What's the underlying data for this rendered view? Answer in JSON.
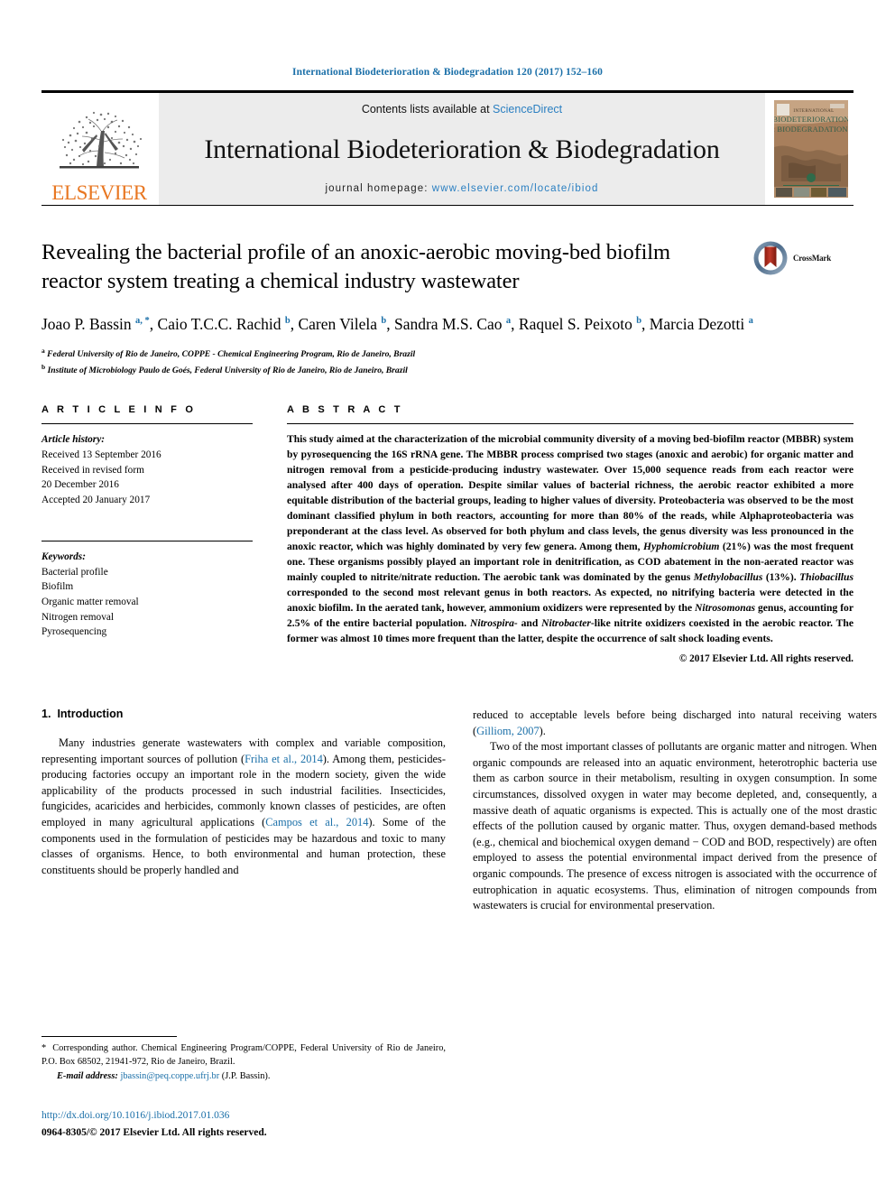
{
  "running_head": "International Biodeterioration & Biodegradation 120 (2017) 152–160",
  "masthead": {
    "elsevier_wordmark": "ELSEVIER",
    "elsevier_logo_color": "#E87722",
    "contents_prefix": "Contents lists available at ",
    "contents_link": "ScienceDirect",
    "journal_name": "International Biodeterioration & Biodegradation",
    "homepage_prefix": "journal homepage: ",
    "homepage_url": "www.elsevier.com/locate/ibiod",
    "link_color": "#2a7fc1",
    "cover_title_line1": "INTERNATIONAL",
    "cover_title_line2": "BIODETERIORATION",
    "cover_title_line3": "& BIODEGRADATION"
  },
  "article": {
    "title": "Revealing the bacterial profile of an anoxic-aerobic moving-bed biofilm reactor system treating a chemical industry wastewater",
    "crossmark_label": "CrossMark",
    "authors": [
      {
        "name": "Joao P. Bassin",
        "marks": "a, *"
      },
      {
        "name": "Caio T.C.C. Rachid",
        "marks": "b"
      },
      {
        "name": "Caren Vilela",
        "marks": "b"
      },
      {
        "name": "Sandra M.S. Cao",
        "marks": "a"
      },
      {
        "name": "Raquel S. Peixoto",
        "marks": "b"
      },
      {
        "name": "Marcia Dezotti",
        "marks": "a"
      }
    ],
    "affiliations": [
      {
        "mark": "a",
        "text": "Federal University of Rio de Janeiro, COPPE - Chemical Engineering Program, Rio de Janeiro, Brazil"
      },
      {
        "mark": "b",
        "text": "Institute of Microbiology Paulo de Goés, Federal University of Rio de Janeiro, Rio de Janeiro, Brazil"
      }
    ]
  },
  "article_info": {
    "heading": "A R T I C L E   I N F O",
    "history_title": "Article history:",
    "history": [
      "Received 13 September 2016",
      "Received in revised form",
      "20 December 2016",
      "Accepted 20 January 2017"
    ],
    "keywords_title": "Keywords:",
    "keywords": [
      "Bacterial profile",
      "Biofilm",
      "Organic matter removal",
      "Nitrogen removal",
      "Pyrosequencing"
    ]
  },
  "abstract": {
    "heading": "A B S T R A C T",
    "paragraph_html": "This study aimed at the characterization of the microbial community diversity of a moving bed-biofilm reactor (MBBR) system by pyrosequencing the 16S rRNA gene. The MBBR process comprised two stages (anoxic and aerobic) for organic matter and nitrogen removal from a pesticide-producing industry wastewater. Over 15,000 sequence reads from each reactor were analysed after 400 days of operation. Despite similar values of bacterial richness, the aerobic reactor exhibited a more equitable distribution of the bacterial groups, leading to higher values of diversity. Proteobacteria was observed to be the most dominant classified phylum in both reactors, accounting for more than 80% of the reads, while Alphaproteobacteria was preponderant at the class level. As observed for both phylum and class levels, the genus diversity was less pronounced in the anoxic reactor, which was highly dominated by very few genera. Among them, <i>Hyphomicrobium</i> (21%) was the most frequent one. These organisms possibly played an important role in denitrification, as COD abatement in the non-aerated reactor was mainly coupled to nitrite/nitrate reduction. The aerobic tank was dominated by the genus <i>Methylobacillus</i> (13%). <i>Thiobacillus</i> corresponded to the second most relevant genus in both reactors. As expected, no nitrifying bacteria were detected in the anoxic biofilm. In the aerated tank, however, ammonium oxidizers were represented by the <i>Nitrosomonas</i> genus, accounting for 2.5% of the entire bacterial population. <i>Nitrospira-</i> and <i>Nitrobacter</i>-like nitrite oxidizers coexisted in the aerobic reactor. The former was almost 10 times more frequent than the latter, despite the occurrence of salt shock loading events.",
    "copyright": "© 2017 Elsevier Ltd. All rights reserved."
  },
  "introduction": {
    "number": "1.",
    "heading": "Introduction",
    "left_paragraph_html": "Many industries generate wastewaters with complex and variable composition, representing important sources of pollution (<span class=\"cite\">Friha et al., 2014</span>). Among them, pesticides-producing factories occupy an important role in the modern society, given the wide applicability of the products processed in such industrial facilities. Insecticides, fungicides, acaricides and herbicides, commonly known classes of pesticides, are often employed in many agricultural applications (<span class=\"cite\">Campos et al., 2014</span>). Some of the components used in the formulation of pesticides may be hazardous and toxic to many classes of organisms. Hence, to both environmental and human protection, these constituents should be properly handled and",
    "right_paragraph1_html": "reduced to acceptable levels before being discharged into natural receiving waters (<span class=\"cite\">Gilliom, 2007</span>).",
    "right_paragraph2_html": "Two of the most important classes of pollutants are organic matter and nitrogen. When organic compounds are released into an aquatic environment, heterotrophic bacteria use them as carbon source in their metabolism, resulting in oxygen consumption. In some circumstances, dissolved oxygen in water may become depleted, and, consequently, a massive death of aquatic organisms is expected. This is actually one of the most drastic effects of the pollution caused by organic matter. Thus, oxygen demand-based methods (e.g., chemical and biochemical oxygen demand &minus; COD and BOD, respectively) are often employed to assess the potential environmental impact derived from the presence of organic compounds. The presence of excess nitrogen is associated with the occurrence of eutrophication in aquatic ecosystems. Thus, elimination of nitrogen compounds from wastewaters is crucial for environmental preservation."
  },
  "footer": {
    "corresponding_html": "<span class=\"star\">*</span> Corresponding author. Chemical Engineering Program/COPPE, Federal University of Rio de Janeiro, P.O. Box 68502, 21941-972, Rio de Janeiro, Brazil.",
    "email_label": "E-mail address:",
    "email": "jbassin@peq.coppe.ufrj.br",
    "email_suffix": "(J.P. Bassin).",
    "doi_url": "http://dx.doi.org/10.1016/j.ibiod.2017.01.036",
    "issn_line": "0964-8305/© 2017 Elsevier Ltd. All rights reserved.",
    "link_color": "#1a6fa8"
  }
}
